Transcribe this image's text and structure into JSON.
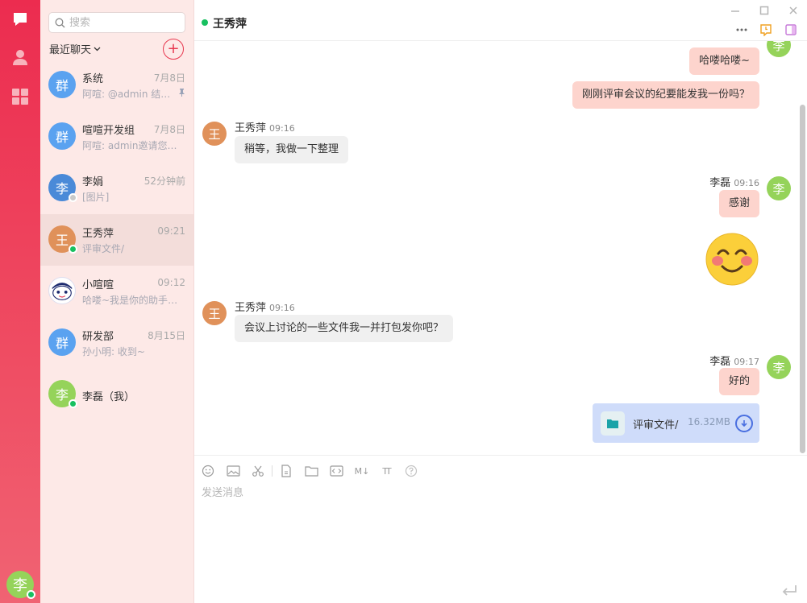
{
  "rail": {
    "items": [
      {
        "name": "chat",
        "icon": "chat-bubble-icon"
      },
      {
        "name": "contacts",
        "icon": "person-icon"
      },
      {
        "name": "apps",
        "icon": "grid-icon"
      }
    ],
    "self_avatar": "李",
    "brand_color": "#ec2c4f"
  },
  "sidebar": {
    "search_placeholder": "搜索",
    "recent_label": "最近聊天",
    "add_icon": "plus-icon",
    "sessions": [
      {
        "avatar": "群",
        "avatar_color": "#5aa2f0",
        "name": "系统",
        "time": "7月8日",
        "preview": "阿喧: @admin 结束…",
        "pinned": true
      },
      {
        "avatar": "群",
        "avatar_color": "#5aa2f0",
        "name": "喧喧开发组",
        "time": "7月8日",
        "preview": "阿喧: admin邀请您参…"
      },
      {
        "avatar": "李",
        "avatar_color": "#4a8ad8",
        "name": "李娟",
        "time": "52分钟前",
        "preview": "[图片]",
        "status": "offline"
      },
      {
        "avatar": "王",
        "avatar_color": "#e0915a",
        "name": "王秀萍",
        "time": "09:21",
        "preview": "评审文件/",
        "status": "online",
        "active": true
      },
      {
        "avatar": "bot",
        "name": "小喧喧",
        "time": "09:12",
        "preview": "哈喽~我是你的助手小…"
      },
      {
        "avatar": "群",
        "avatar_color": "#5aa2f0",
        "name": "研发部",
        "time": "8月15日",
        "preview": "孙小明: 收到~"
      },
      {
        "avatar": "李",
        "avatar_color": "#95d35a",
        "name": "李磊（我）",
        "status": "online"
      }
    ]
  },
  "header": {
    "title": "王秀萍",
    "status_color": "#18c060",
    "more_icon": "more-icon",
    "history_icon": "clock-icon",
    "sidebar_toggle_icon": "panel-icon"
  },
  "window": {
    "minimize": "minimize-icon",
    "maximize": "maximize-icon",
    "close": "close-icon"
  },
  "messages": [
    {
      "from": "me",
      "avatar": "李",
      "text": "哈喽哈喽~"
    },
    {
      "from": "me",
      "text": "刚刚评审会议的纪要能发我一份吗？"
    },
    {
      "from": "other",
      "avatar": "王",
      "name": "王秀萍",
      "time": "09:16",
      "text": "稍等，我做一下整理"
    },
    {
      "from": "me",
      "avatar": "李",
      "name": "李磊",
      "time": "09:16",
      "text": "感谢"
    },
    {
      "from": "me",
      "emoji": "smiling-face-emoji"
    },
    {
      "from": "other",
      "avatar": "王",
      "name": "王秀萍",
      "time": "09:16",
      "text": "会议上讨论的一些文件我一并打包发你吧？"
    },
    {
      "from": "me",
      "avatar": "李",
      "name": "李磊",
      "time": "09:17",
      "text": "好的"
    },
    {
      "from": "me",
      "file": {
        "name": "评审文件/",
        "size": "16.32MB",
        "icon": "folder-icon",
        "action": "download-icon"
      }
    }
  ],
  "editor": {
    "placeholder": "发送消息",
    "tools": [
      "emoji-icon",
      "image-icon",
      "scissors-icon",
      "file-icon",
      "folder-icon",
      "code-icon",
      "markdown-icon",
      "font-size-icon",
      "help-icon"
    ],
    "markdown_label": "M↓",
    "font_label": "TT",
    "send_icon": "send-enter-icon"
  }
}
